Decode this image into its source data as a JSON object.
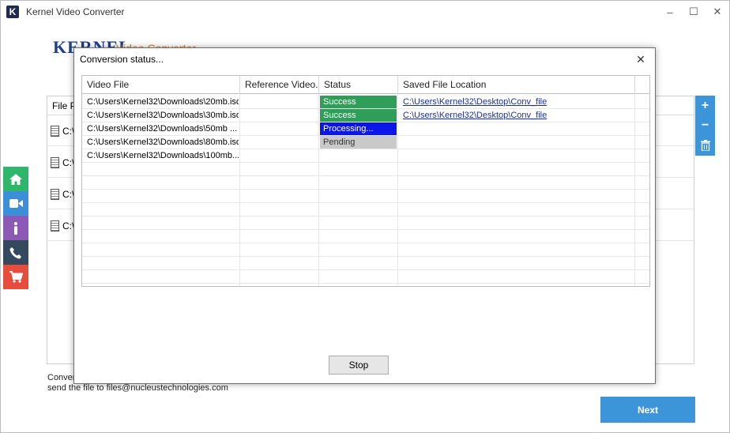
{
  "window": {
    "title": "Kernel Video Converter",
    "icon_letter": "K"
  },
  "brand": {
    "name": "KERNEL",
    "subtitle": "Video Converter"
  },
  "background": {
    "column_header": "File Pa",
    "rows": [
      "C:\\",
      "C:\\",
      "C:\\",
      "C:\\"
    ]
  },
  "sidebar": {
    "items": [
      "home-icon",
      "video-icon",
      "info-icon",
      "phone-icon",
      "cart-icon"
    ]
  },
  "footer": {
    "line1": "Conver",
    "line2": "send the file to files@nucleustechnologies.com",
    "next_label": "Next"
  },
  "modal": {
    "title": "Conversion status...",
    "close_label": "✕",
    "columns": [
      "Video File",
      "Reference Video...",
      "Status",
      "Saved File Location"
    ],
    "rows": [
      {
        "file": "C:\\Users\\Kernel32\\Downloads\\20mb.iso",
        "ref": "",
        "status": "Success",
        "status_type": "success",
        "location": "C:\\Users\\Kernel32\\Desktop\\Conv_file"
      },
      {
        "file": "C:\\Users\\Kernel32\\Downloads\\30mb.iso",
        "ref": "",
        "status": "Success",
        "status_type": "success",
        "location": "C:\\Users\\Kernel32\\Desktop\\Conv_file"
      },
      {
        "file": "C:\\Users\\Kernel32\\Downloads\\50mb ...",
        "ref": "",
        "status": "Processing...",
        "status_type": "processing",
        "location": ""
      },
      {
        "file": "C:\\Users\\Kernel32\\Downloads\\80mb.iso",
        "ref": "",
        "status": "Pending",
        "status_type": "pending",
        "location": ""
      },
      {
        "file": "C:\\Users\\Kernel32\\Downloads\\100mb....",
        "ref": "",
        "status": "",
        "status_type": "",
        "location": ""
      }
    ],
    "stop_label": "Stop"
  }
}
